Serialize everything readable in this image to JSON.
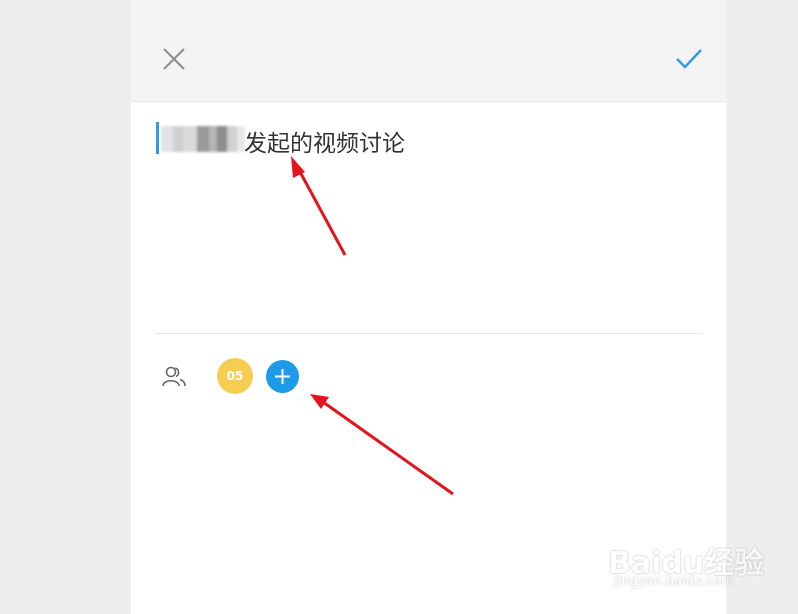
{
  "editor": {
    "title_suffix": "发起的视频讨论"
  },
  "participants": {
    "avatar_initials": "05"
  },
  "icons": {
    "close": "close-icon",
    "confirm": "checkmark-icon",
    "members": "members-icon",
    "add": "plus-icon"
  },
  "colors": {
    "accent": "#1e9be8",
    "avatar_bg": "#f5cd52",
    "annotation_arrow": "#e3141b"
  },
  "watermark": {
    "brand": "Baidu经验",
    "url": "jingyan.baidu.com"
  }
}
